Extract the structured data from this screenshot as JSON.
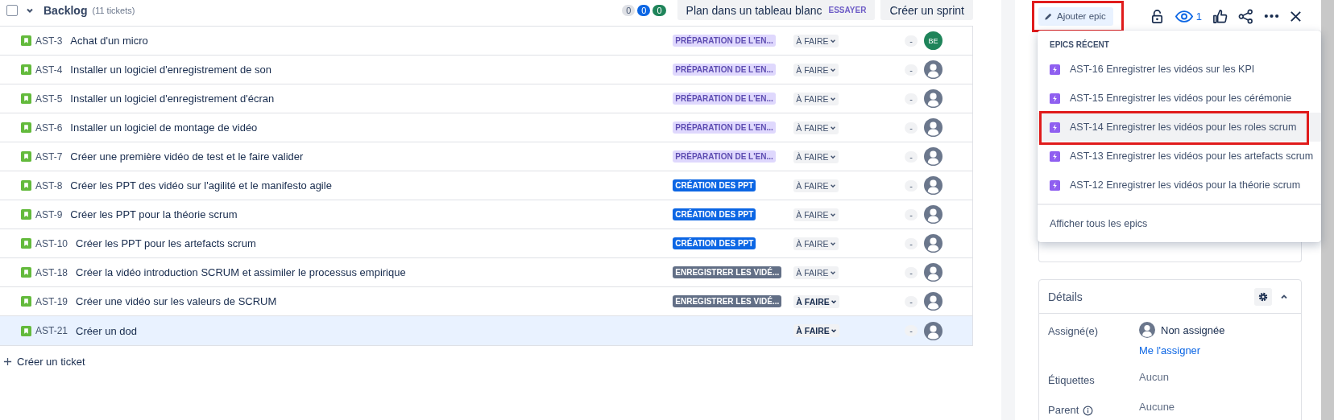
{
  "backlog": {
    "title": "Backlog",
    "count": "(11 tickets)",
    "checked": false,
    "expanded": true,
    "counters": [
      {
        "value": "0",
        "color": "#dfe1e6"
      },
      {
        "value": "0",
        "color": "#0c66e4"
      },
      {
        "value": "0",
        "color": "#1f845a"
      }
    ],
    "whiteboard_button": {
      "label": "Plan dans un tableau blanc",
      "badge": "ESSAYER"
    },
    "sprint_button": "Créer un sprint",
    "rows": [
      {
        "key": "AST-3",
        "summary": "Achat d'un micro",
        "epic": {
          "label": "PRÉPARATION DE L'EN...",
          "color": "#dfd8fd"
        },
        "status": "À FAIRE",
        "status_emphasized": false,
        "estimate": "-",
        "assignee": {
          "kind": "initials",
          "initials": "BE"
        },
        "selected": false
      },
      {
        "key": "AST-4",
        "summary": "Installer un logiciel d'enregistrement de son",
        "epic": {
          "label": "PRÉPARATION DE L'EN...",
          "color": "#dfd8fd"
        },
        "status": "À FAIRE",
        "status_emphasized": false,
        "estimate": "-",
        "assignee": {
          "kind": "none"
        },
        "selected": false
      },
      {
        "key": "AST-5",
        "summary": "Installer un logiciel d'enregistrement d'écran",
        "epic": {
          "label": "PRÉPARATION DE L'EN...",
          "color": "#dfd8fd"
        },
        "status": "À FAIRE",
        "status_emphasized": false,
        "estimate": "-",
        "assignee": {
          "kind": "none"
        },
        "selected": false
      },
      {
        "key": "AST-6",
        "summary": "Installer un logiciel de montage de vidéo",
        "epic": {
          "label": "PRÉPARATION DE L'EN...",
          "color": "#dfd8fd"
        },
        "status": "À FAIRE",
        "status_emphasized": false,
        "estimate": "-",
        "assignee": {
          "kind": "none"
        },
        "selected": false
      },
      {
        "key": "AST-7",
        "summary": "Créer une première vidéo de test et le faire valider",
        "epic": {
          "label": "PRÉPARATION DE L'EN...",
          "color": "#dfd8fd"
        },
        "status": "À FAIRE",
        "status_emphasized": false,
        "estimate": "-",
        "assignee": {
          "kind": "none"
        },
        "selected": false
      },
      {
        "key": "AST-8",
        "summary": "Créer les PPT des vidéo sur l'agilité et le manifesto agile",
        "epic": {
          "label": "CRÉATION DES PPT",
          "color": "#0c66e4"
        },
        "status": "À FAIRE",
        "status_emphasized": false,
        "estimate": "-",
        "assignee": {
          "kind": "none"
        },
        "selected": false
      },
      {
        "key": "AST-9",
        "summary": "Créer les PPT pour la théorie scrum",
        "epic": {
          "label": "CRÉATION DES PPT",
          "color": "#0c66e4"
        },
        "status": "À FAIRE",
        "status_emphasized": false,
        "estimate": "-",
        "assignee": {
          "kind": "none"
        },
        "selected": false
      },
      {
        "key": "AST-10",
        "summary": "Créer les PPT pour les artefacts scrum",
        "epic": {
          "label": "CRÉATION DES PPT",
          "color": "#0c66e4"
        },
        "status": "À FAIRE",
        "status_emphasized": false,
        "estimate": "-",
        "assignee": {
          "kind": "none"
        },
        "selected": false
      },
      {
        "key": "AST-18",
        "summary": "Créer la vidéo introduction SCRUM et assimiler le processus empirique",
        "epic": {
          "label": "ENREGISTRER LES VIDÉ...",
          "color": "#626f86"
        },
        "status": "À FAIRE",
        "status_emphasized": false,
        "estimate": "-",
        "assignee": {
          "kind": "none"
        },
        "selected": false
      },
      {
        "key": "AST-19",
        "summary": "Créer une vidéo sur les valeurs de SCRUM",
        "epic": {
          "label": "ENREGISTRER LES VIDÉ...",
          "color": "#626f86"
        },
        "status": "À FAIRE",
        "status_emphasized": true,
        "estimate": "-",
        "assignee": {
          "kind": "none"
        },
        "selected": false
      },
      {
        "key": "AST-21",
        "summary": "Créer un dod",
        "status": "À FAIRE",
        "status_emphasized": true,
        "estimate": "-",
        "assignee": {
          "kind": "none"
        },
        "selected": true
      }
    ],
    "create_ticket": "Créer un ticket"
  },
  "detail_panel": {
    "epic_button": {
      "label": "Ajouter epic",
      "annotated": true
    },
    "watchers": "1",
    "epic_menu": {
      "heading": "EPICS RÉCENT",
      "items": [
        {
          "label": "AST-16 Enregistrer les vidéos sur les KPI",
          "selected": false,
          "annotated": false
        },
        {
          "label": "AST-15 Enregistrer les vidéos pour les cérémonie",
          "selected": false,
          "annotated": false
        },
        {
          "label": "AST-14 Enregistrer les vidéos pour les roles scrum",
          "selected": true,
          "annotated": true
        },
        {
          "label": "AST-13 Enregistrer les vidéos pour les artefacts scrum",
          "selected": false,
          "annotated": false
        },
        {
          "label": "AST-12 Enregistrer les vidéos pour la théorie scrum",
          "selected": false,
          "annotated": false
        }
      ],
      "footer": "Afficher tous les epics"
    },
    "details": {
      "title": "Détails",
      "expanded": true,
      "fields": [
        {
          "label": "Assigné(e)",
          "kind": "assignee",
          "value": "Non assignée",
          "action": "Me l'assigner"
        },
        {
          "label": "Étiquettes",
          "kind": "text",
          "value": "Aucun"
        },
        {
          "label": "Parent",
          "kind": "text",
          "value": "Aucune",
          "info": true
        }
      ]
    }
  }
}
